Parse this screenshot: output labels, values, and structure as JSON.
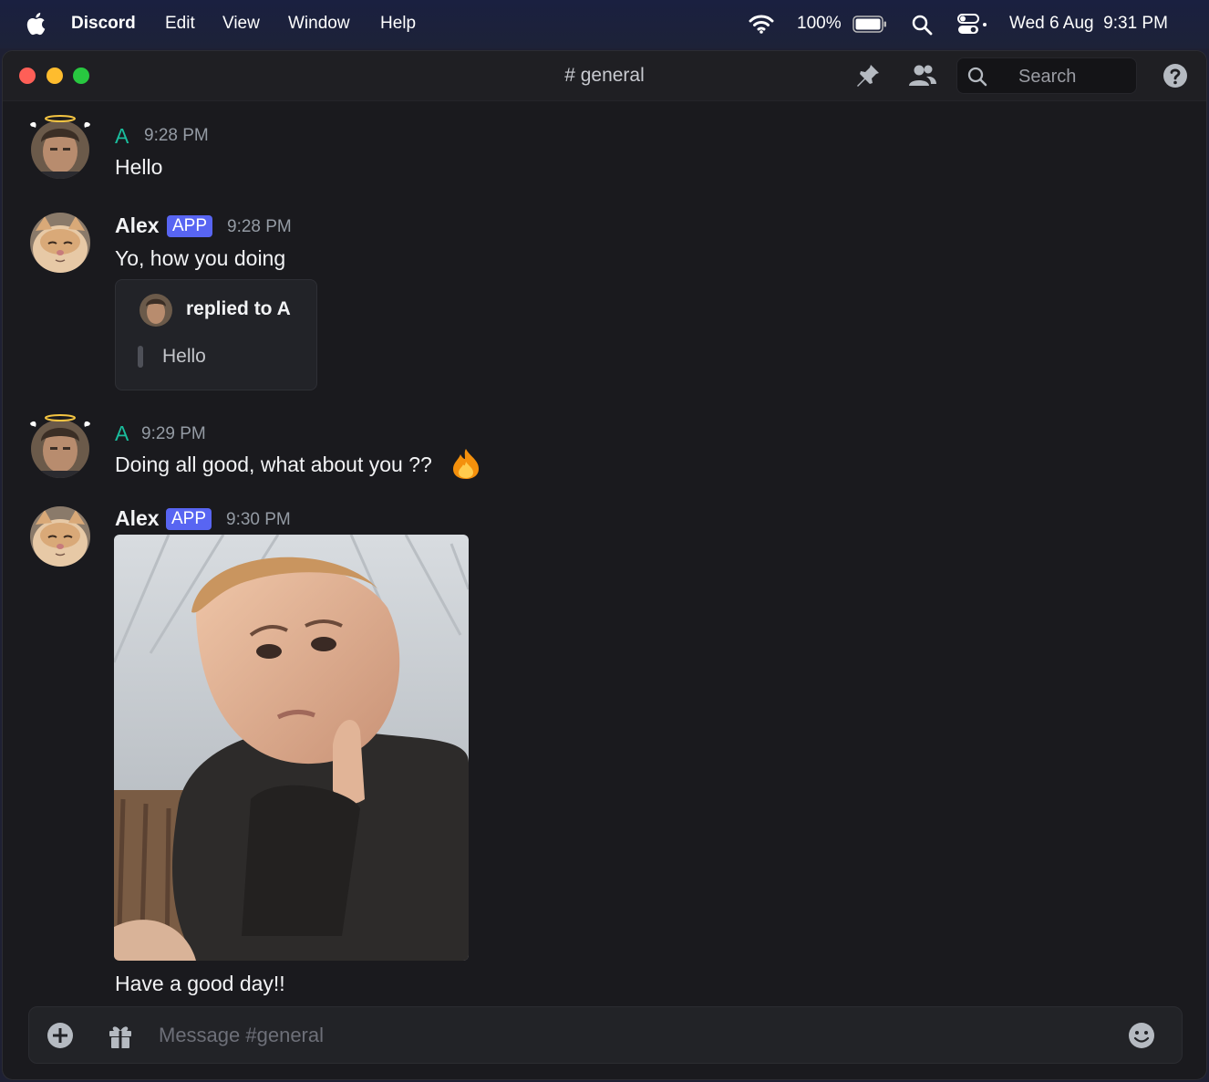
{
  "menubar": {
    "app_name": "Discord",
    "menus": [
      "Edit",
      "View",
      "Window",
      "Help"
    ],
    "battery": "100%",
    "datetime": "Wed 6 Aug  9:31 PM"
  },
  "window": {
    "title": "# general",
    "search_label": "Search"
  },
  "messages": [
    {
      "author": "A",
      "time": "9:28 PM",
      "text": "Hello"
    },
    {
      "author": "Alex",
      "badge": "APP",
      "time": "9:28 PM",
      "text": "Yo, how you doing",
      "reply": {
        "title": "replied to A",
        "quote": "Hello"
      }
    },
    {
      "author": "A",
      "time": "9:29 PM",
      "text": "Doing all good, what about you ??",
      "emoji": "fire-emoji"
    },
    {
      "author": "Alex",
      "badge": "APP",
      "time": "9:30 PM",
      "image": "baby-thumbs-up-photo",
      "text": "Have a good day!!"
    }
  ],
  "composer": {
    "placeholder": "Message #general"
  },
  "colors": {
    "accent": "#5865f2",
    "user_a": "#1abc9c",
    "background": "#1a1a1e"
  }
}
